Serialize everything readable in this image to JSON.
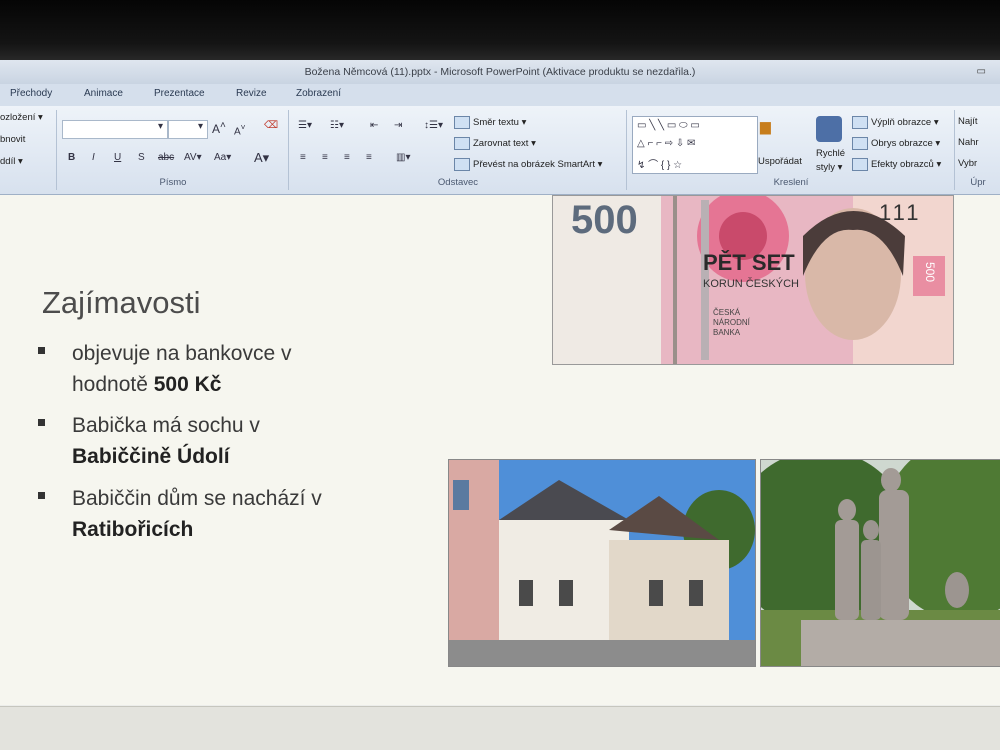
{
  "window": {
    "title": "Božena Němcová (11).pptx  -  Microsoft PowerPoint (Aktivace produktu se nezdařila.)"
  },
  "tabs": [
    "Přechody",
    "Animace",
    "Prezentace",
    "Revize",
    "Zobrazení"
  ],
  "ribbon": {
    "left_items": [
      "ozložení ▾",
      "bnovit",
      "ddíl ▾"
    ],
    "groups": {
      "font": "Písmo",
      "paragraph": "Odstavec",
      "drawing": "Kreslení",
      "editing": "Úpr"
    },
    "paragraph_cmds": {
      "text_direction": "Směr textu ▾",
      "align_text": "Zarovnat text ▾",
      "smartart": "Převést na obrázek SmartArt ▾"
    },
    "drawing_cmds": {
      "arrange": "Uspořádat",
      "quick_styles_1": "Rychlé",
      "quick_styles_2": "styly ▾",
      "shape_fill": "Výplň obrazce ▾",
      "shape_outline": "Obrys obrazce ▾",
      "shape_effects": "Efekty obrazců ▾"
    },
    "editing_cmds": {
      "find": "Najít",
      "replace": "Nahr",
      "select": "Vybr"
    }
  },
  "slide": {
    "heading": "Zajímavosti",
    "bullets": [
      {
        "line1": "objevuje na bankovce v",
        "line2_pre": "hodnotě ",
        "line2_bold": "500 Kč"
      },
      {
        "line1": "Babička má sochu v",
        "line2_pre": "",
        "line2_bold": "Babiččině Údolí"
      },
      {
        "line1": "Babiččin dům se nachází v",
        "line2_pre": "",
        "line2_bold": "Ratibořicích"
      }
    ],
    "banknote": {
      "value": "500",
      "serial": "111",
      "text_main": "PĚT SET",
      "text_sub": "KORUN ČESKÝCH",
      "bank": "ČESKÁ NÁRODNÍ BANKA",
      "side_value": "500"
    }
  },
  "colors": {
    "ribbon_bg": "#dbe4ef",
    "slide_bg": "#f6f6ef",
    "banknote_pink": "#e46a8c",
    "sky": "#4f8fd8",
    "foliage": "#3f6a2e"
  }
}
